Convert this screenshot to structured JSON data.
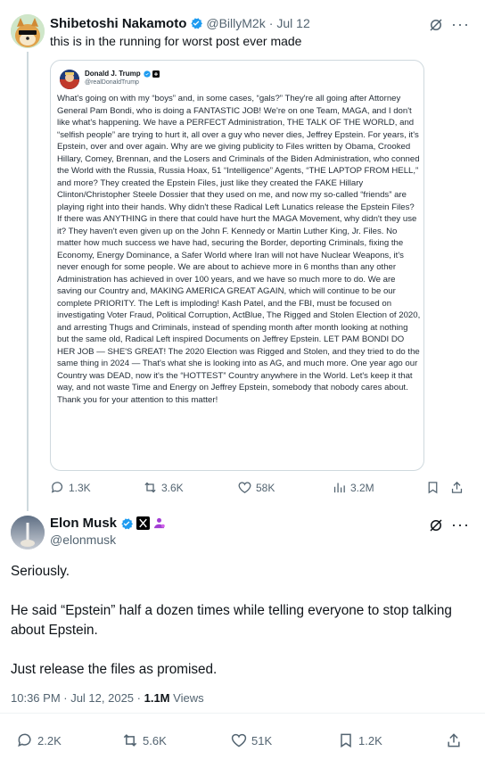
{
  "parent": {
    "name": "Shibetoshi Nakamoto",
    "handle": "@BillyM2k",
    "sep": "·",
    "date": "Jul 12",
    "text": "this is in the running for worst post ever made",
    "quoted": {
      "name": "Donald J. Trump",
      "handle": "@realDonaldTrump",
      "body": "What's going on with my “boys” and, in some cases, “gals?” They're all going after Attorney General Pam Bondi, who is doing a FANTASTIC JOB! We're on one Team, MAGA, and I don't like what's happening. We have a PERFECT Administration, THE TALK OF THE WORLD, and “selfish people” are trying to hurt it, all over a guy who never dies, Jeffrey Epstein. For years, it's Epstein, over and over again. Why are we giving publicity to Files written by Obama, Crooked Hillary, Comey, Brennan, and the Losers and Criminals of the Biden Administration, who conned the World with the Russia, Russia Hoax, 51 “Intelligence” Agents, “THE LAPTOP FROM HELL,” and more? They created the Epstein Files, just like they created the FAKE Hillary Clinton/Christopher Steele Dossier that they used on me, and now my so-called “friends” are playing right into their hands. Why didn't these Radical Left Lunatics release the Epstein Files? If there was ANYTHING in there that could have hurt the MAGA Movement, why didn't they use it? They haven't even given up on the John F. Kennedy or Martin Luther King, Jr. Files. No matter how much success we have had, securing the Border, deporting Criminals, fixing the Economy, Energy Dominance, a Safer World where Iran will not have Nuclear Weapons, it's never enough for some people. We are about to achieve more in 6 months than any other Administration has achieved in over 100 years, and we have so much more to do. We are saving our Country and, MAKING AMERICA GREAT AGAIN, which will continue to be our complete PRIORITY. The Left is imploding! Kash Patel, and the FBI, must be focused on investigating Voter Fraud, Political Corruption, ActBlue, The Rigged and Stolen Election of 2020, and arresting Thugs and Criminals, instead of spending month after month looking at nothing but the same old, Radical Left inspired Documents on Jeffrey Epstein. LET PAM BONDI DO HER JOB — SHE'S GREAT! The 2020 Election was Rigged and Stolen, and they tried to do the same thing in 2024 — That's what she is looking into as AG, and much more. One year ago our Country was DEAD, now it's the “HOTTEST” Country anywhere in the World. Let's keep it that way, and not waste Time and Energy on Jeffrey Epstein, somebody that nobody cares about. Thank you for your attention to this matter!"
    },
    "stats": {
      "replies": "1.3K",
      "reposts": "3.6K",
      "likes": "58K",
      "views": "3.2M"
    }
  },
  "main": {
    "name": "Elon Musk",
    "handle": "@elonmusk",
    "paragraphs": [
      "Seriously.",
      "He said “Epstein” half a dozen times while telling everyone to stop talking about Epstein.",
      "Just release the files as promised."
    ],
    "time": "10:36 PM · Jul 12, 2025 ·",
    "views_count": "1.1M",
    "views_label": "Views",
    "stats": {
      "replies": "2.2K",
      "reposts": "5.6K",
      "likes": "51K",
      "bookmarks": "1.2K"
    }
  },
  "icons": {
    "verified": "verified-badge-icon",
    "grok": "grok-icon",
    "more": "more-icon",
    "reply": "reply-icon",
    "repost": "repost-icon",
    "like": "like-icon",
    "views": "views-icon",
    "bookmark": "bookmark-icon",
    "share": "share-icon"
  },
  "colors": {
    "verified": "#1d9bf0",
    "muted": "#536471",
    "border": "#cfd9de"
  }
}
